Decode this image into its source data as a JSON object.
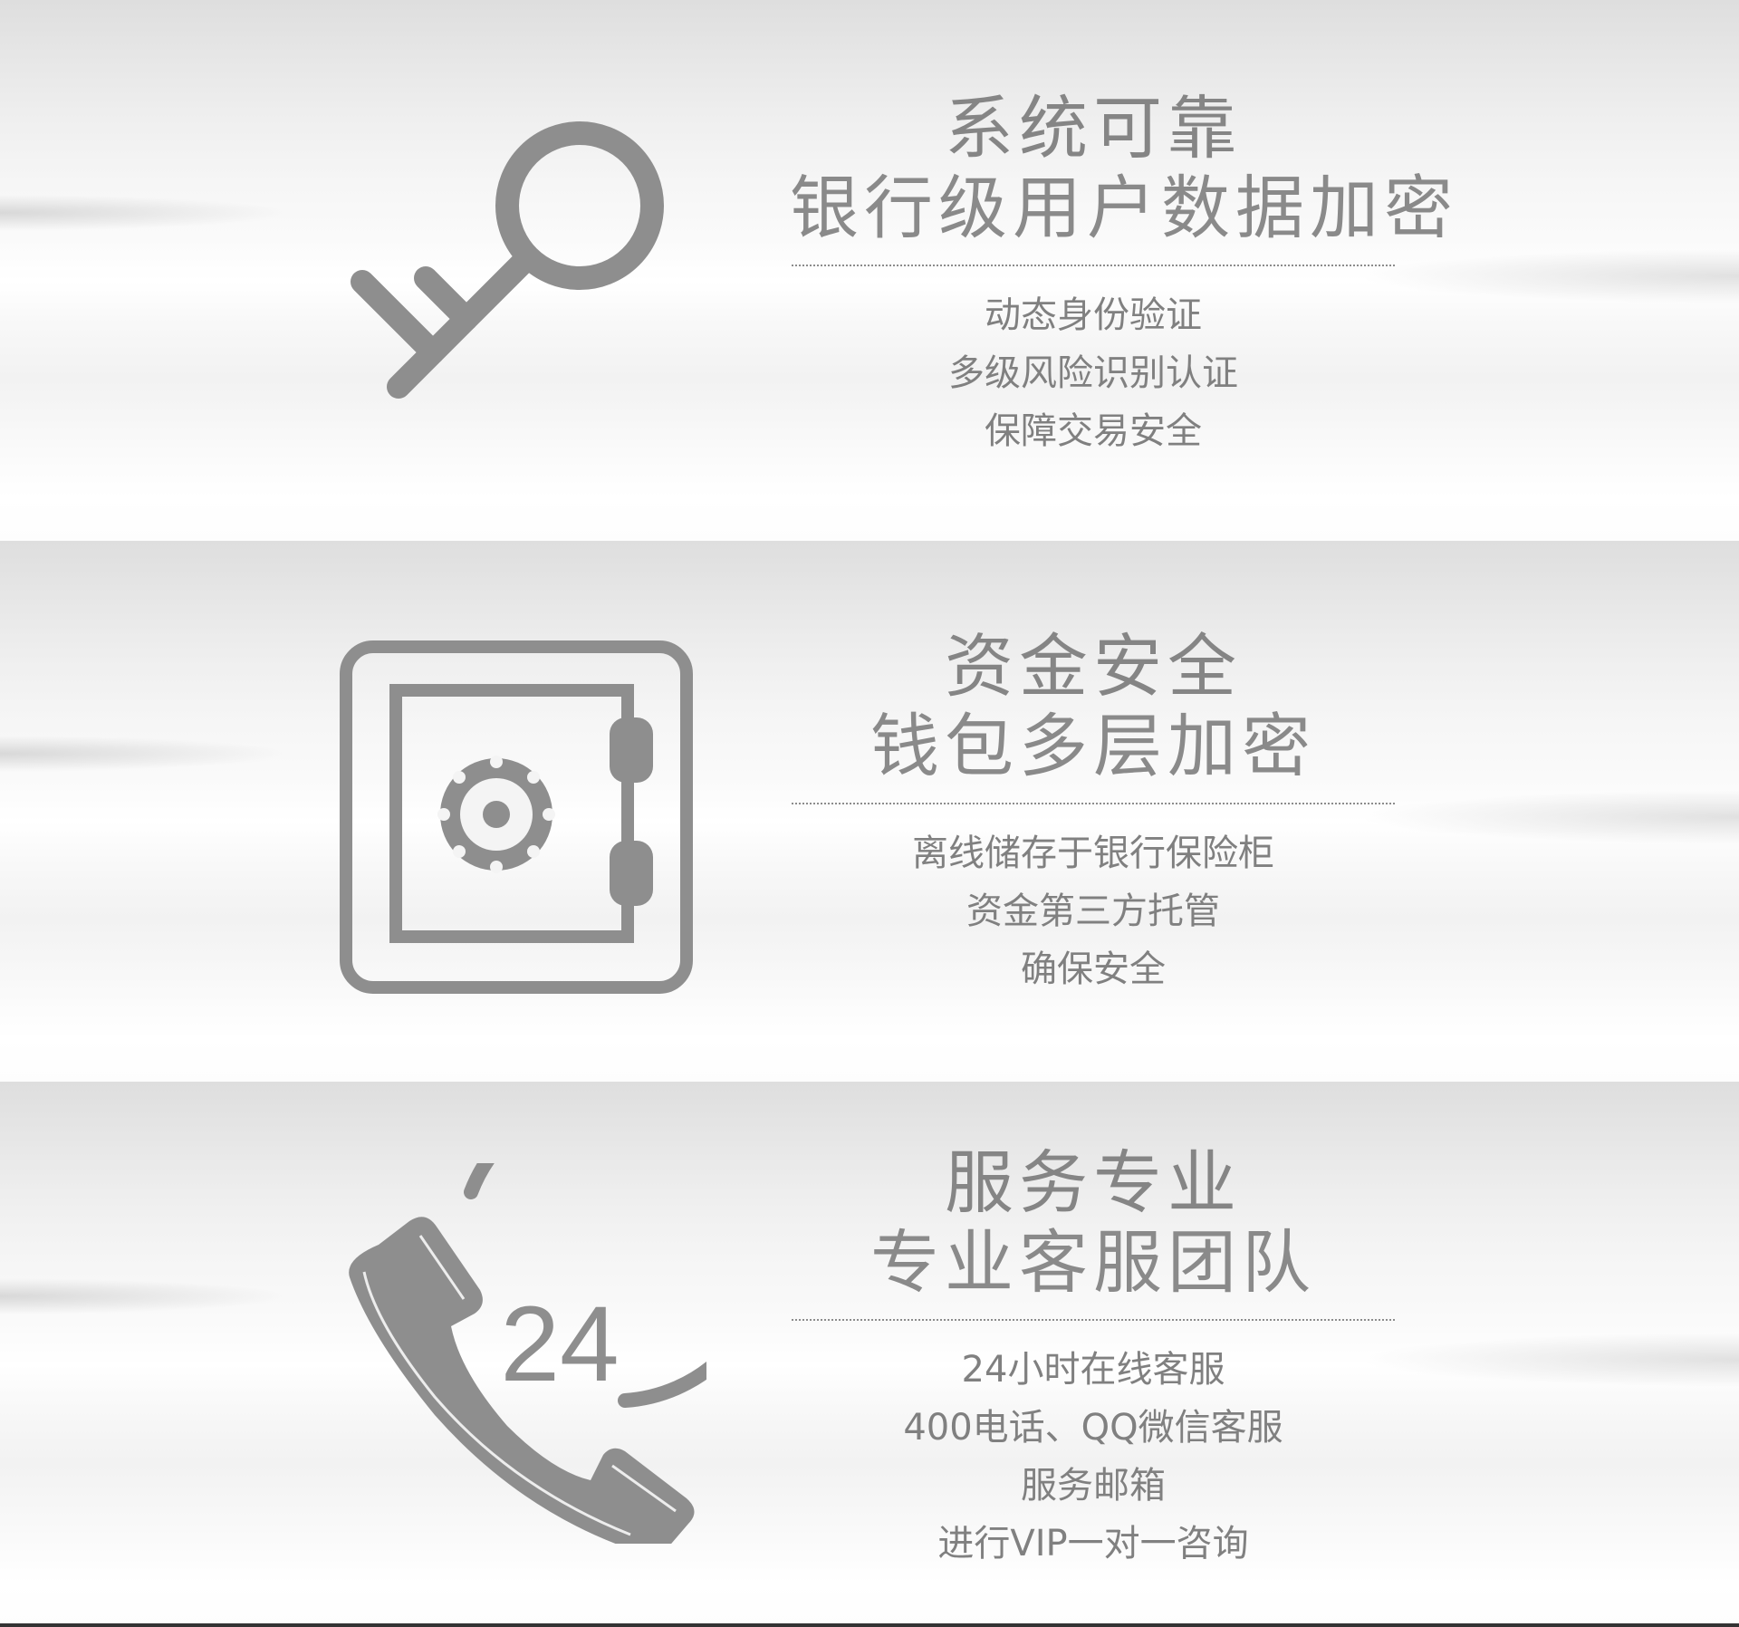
{
  "sections": [
    {
      "icon": "key-icon",
      "title": "系统可靠",
      "subtitle": "银行级用户数据加密",
      "lines": [
        "动态身份验证",
        "多级风险识别认证",
        "保障交易安全"
      ]
    },
    {
      "icon": "safe-icon",
      "title": "资金安全",
      "subtitle": "钱包多层加密",
      "lines": [
        "离线储存于银行保险柜",
        "资金第三方托管",
        "确保安全"
      ]
    },
    {
      "icon": "phone-24-icon",
      "icon_text": "24",
      "title": "服务专业",
      "subtitle": "专业客服团队",
      "lines": [
        "24小时在线客服",
        "400电话、QQ微信客服",
        "服务邮箱",
        "进行VIP一对一咨询"
      ]
    }
  ],
  "colors": {
    "icon": "#8e8e8e",
    "text": "#808080"
  }
}
